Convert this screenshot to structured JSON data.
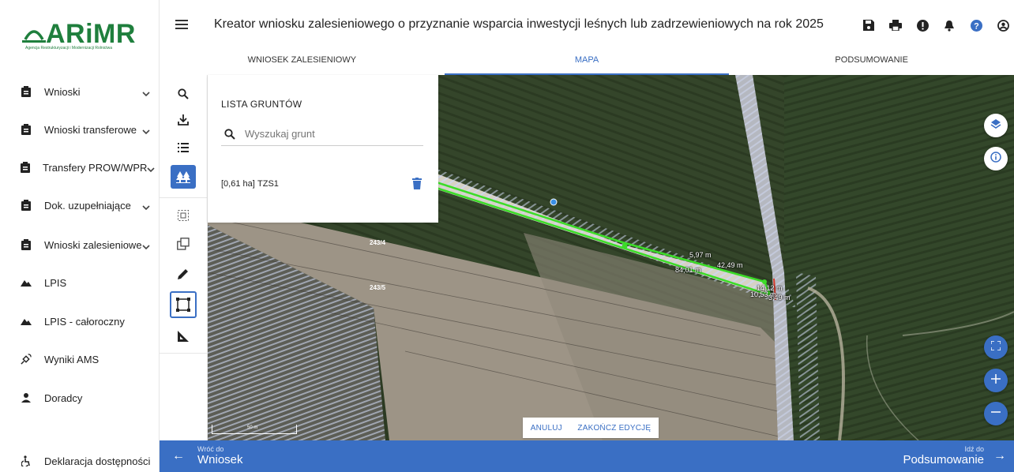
{
  "brand": {
    "logo_text": "ARiMR",
    "logo_subtitle": "Agencja Restrukturyzacji i Modernizacji Rolnictwa"
  },
  "sidebar": {
    "items": [
      {
        "label": "Wnioski",
        "icon": "clipboard-icon",
        "has_chevron": true
      },
      {
        "label": "Wnioski transferowe",
        "icon": "clipboard-icon",
        "has_chevron": true
      },
      {
        "label": "Transfery PROW/WPR",
        "icon": "clipboard-icon",
        "has_chevron": true
      },
      {
        "label": "Dok. uzupełniające",
        "icon": "clipboard-icon",
        "has_chevron": true
      },
      {
        "label": "Wnioski zalesieniowe",
        "icon": "clipboard-icon",
        "has_chevron": true
      },
      {
        "label": "LPIS",
        "icon": "mountain-icon",
        "has_chevron": false
      },
      {
        "label": "LPIS - całoroczny",
        "icon": "mountain-icon",
        "has_chevron": false
      },
      {
        "label": "Wyniki AMS",
        "icon": "satellite-icon",
        "has_chevron": false
      },
      {
        "label": "Doradcy",
        "icon": "person-icon",
        "has_chevron": false
      }
    ],
    "footer_item": {
      "label": "Deklaracja dostępności",
      "icon": "accessibility-icon"
    }
  },
  "header": {
    "title": "Kreator wniosku zalesieniowego o przyznanie wsparcia inwestycji leśnych lub zadrzewieniowych na rok 2025",
    "icons": [
      "save-icon",
      "print-icon",
      "alert-icon",
      "bell-icon",
      "help-icon",
      "account-icon"
    ]
  },
  "tabs": [
    {
      "label": "WNIOSEK ZALESIENIOWY",
      "active": false
    },
    {
      "label": "MAPA",
      "active": true
    },
    {
      "label": "PODSUMOWANIE",
      "active": false
    }
  ],
  "tools": [
    "search-icon",
    "download-icon",
    "list-icon",
    "forest-icon",
    "select-area-icon",
    "copy-shape-icon",
    "pencil-icon",
    "draw-rectangle-icon",
    "measure-angle-icon"
  ],
  "parcel_panel": {
    "title": "LISTA GRUNTÓW",
    "search_placeholder": "Wyszukaj grunt",
    "rows": [
      {
        "area": "[0,61 ha]",
        "name": "TZS1"
      }
    ]
  },
  "map": {
    "parcel_labels": [
      "243/4",
      "243/5"
    ],
    "dimensions": [
      "5,97 m",
      "42,49 m",
      "84,01 m",
      "14,12 m",
      "10,53 m",
      "3,49 m"
    ],
    "scale_label": "50 m",
    "edit_actions": {
      "cancel": "ANULUJ",
      "finish": "ZAKOŃCZ EDYCJĘ"
    },
    "colors": {
      "edit_line": "#3cdc28",
      "vertex_blue": "#3a8fe6",
      "accent": "#3a6fc4"
    }
  },
  "footer": {
    "back_small": "Wróć do",
    "back_big": "Wniosek",
    "next_small": "Idź do",
    "next_big": "Podsumowanie"
  }
}
